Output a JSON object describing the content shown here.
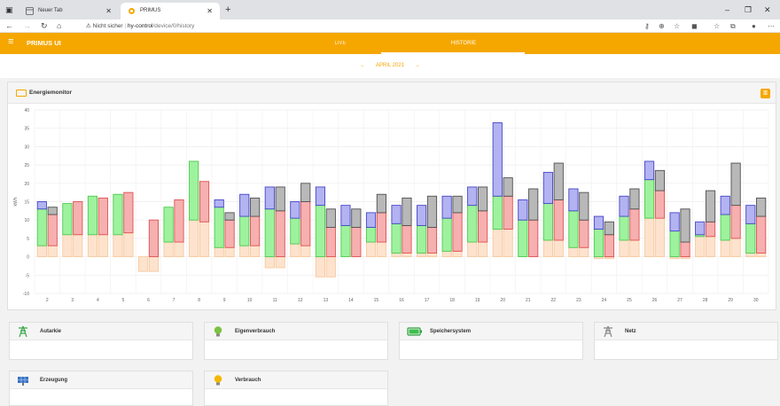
{
  "browser": {
    "tabs": [
      {
        "label": "Neuer Tab",
        "active": false
      },
      {
        "label": "PRIMUS",
        "active": true
      }
    ],
    "address": {
      "security": "Nicht sicher",
      "host": "hy-control",
      "path": "/device/0/history"
    }
  },
  "app": {
    "title": "PRIMUS UI",
    "tabs": [
      "LIVE",
      "HISTORIE"
    ],
    "active_tab": "HISTORIE"
  },
  "date_nav": {
    "label": "APRIL 2021",
    "prev": "←",
    "next": "→"
  },
  "energy_card": {
    "title": "Energiemonitor"
  },
  "colors": {
    "accent": "#f5a700",
    "green": "#9ef29e",
    "red": "#f6b0b0",
    "blue": "#b3b3f2",
    "gray": "#b8b8b8",
    "orange": "#fde3cd"
  },
  "chart_data": {
    "type": "bar",
    "ylabel": "kWh",
    "ylim": [
      -10,
      40
    ],
    "yticks": [
      -10,
      -5,
      0,
      5,
      10,
      15,
      20,
      25,
      30,
      35,
      40
    ],
    "grid": true,
    "categories": [
      "2",
      "3",
      "4",
      "5",
      "6",
      "7",
      "8",
      "9",
      "10",
      "11",
      "12",
      "13",
      "14",
      "15",
      "16",
      "17",
      "18",
      "19",
      "20",
      "21",
      "22",
      "23",
      "24",
      "25",
      "26",
      "27",
      "28",
      "29",
      "30"
    ],
    "left_bars": {
      "orange": [
        3,
        6,
        6,
        6,
        -4,
        4,
        10,
        2.5,
        3,
        -3,
        3.5,
        -5.5,
        0,
        4,
        1,
        1,
        1.5,
        4,
        7.5,
        0,
        4.5,
        2.5,
        -0.5,
        4.5,
        10.5,
        -0.5,
        5.5,
        4.5,
        1
      ],
      "green": [
        13,
        14.5,
        16.5,
        17,
        0,
        13.5,
        26,
        13.5,
        11,
        13,
        10.5,
        14,
        8.5,
        8,
        9,
        8.5,
        10.5,
        14,
        16.5,
        10,
        14.5,
        12.5,
        7.5,
        11,
        21,
        7,
        6,
        11.5,
        9
      ],
      "blue": [
        15,
        14.5,
        16.5,
        17,
        0,
        13.5,
        26,
        15.5,
        17,
        19,
        15,
        19,
        14,
        12,
        14,
        14,
        16.5,
        19,
        36.5,
        15.5,
        23,
        18.5,
        11,
        16.5,
        26,
        12,
        9.5,
        16.5,
        14
      ]
    },
    "right_bars": {
      "orange": [
        3,
        6,
        6,
        6.5,
        -4,
        4,
        9.5,
        2.5,
        3,
        -3,
        3,
        -5.5,
        0,
        4,
        1,
        1,
        1.5,
        4,
        7.5,
        0,
        4.5,
        2.5,
        -0.5,
        4.5,
        10.5,
        -0.5,
        5.5,
        5,
        1
      ],
      "red": [
        11.5,
        15,
        16,
        17.5,
        10,
        15.5,
        20.5,
        10,
        11,
        12.5,
        15,
        8,
        8,
        12,
        8.5,
        8,
        12,
        12.5,
        16.5,
        10,
        15.5,
        10,
        6,
        13,
        18,
        4,
        9.5,
        14,
        11
      ],
      "gray": [
        13.5,
        15,
        16,
        17.5,
        10,
        15.5,
        20.5,
        12,
        16,
        19,
        20,
        13,
        13,
        17,
        16,
        16.5,
        16.5,
        19,
        21.5,
        18.5,
        25.5,
        17.5,
        9.5,
        18.5,
        23.5,
        13,
        18,
        25.5,
        16
      ]
    }
  },
  "tiles": [
    {
      "label": "Autarkie",
      "icon": "pylon-green-icon"
    },
    {
      "label": "Eigenverbrauch",
      "icon": "lightbulb-green-icon"
    },
    {
      "label": "Speichersystem",
      "icon": "battery-icon"
    },
    {
      "label": "Netz",
      "icon": "pylon-gray-icon"
    },
    {
      "label": "Erzeugung",
      "icon": "solar-panel-icon"
    },
    {
      "label": "Verbrauch",
      "icon": "lightbulb-orange-icon"
    }
  ]
}
